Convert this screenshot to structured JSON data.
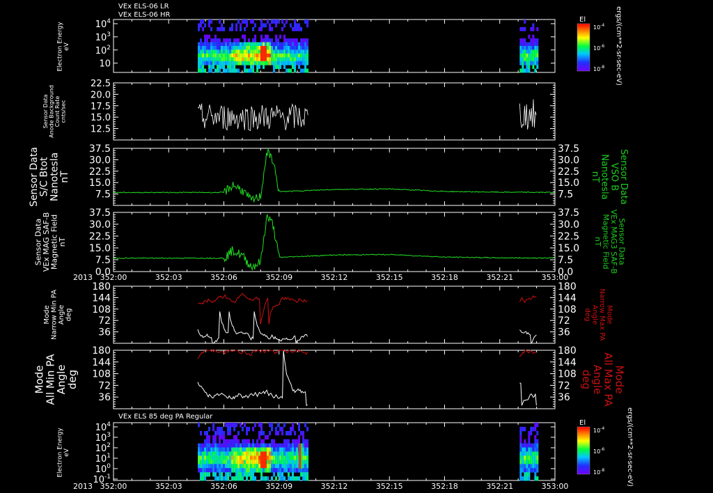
{
  "colors": {
    "background": "#000000",
    "axis": "#ffffff",
    "white_trace": "#ffffff",
    "green_trace": "#22dd22",
    "red_trace": "#cc1111",
    "green_label": "#1fcf1f",
    "red_label": "#cc1111"
  },
  "chart_data": [
    {
      "type": "heatmap",
      "title_lines": [
        "VEx ELS-06 LR",
        "VEx ELS-06 HR"
      ],
      "ylabel": [
        "Electron Energy",
        "eV"
      ],
      "yscale": "log",
      "ytick_labels": [
        [
          "10",
          "4"
        ],
        [
          "10",
          "3"
        ],
        [
          "10",
          "2"
        ],
        [
          "10",
          ""
        ]
      ],
      "colorbar": {
        "title": "El",
        "tick_labels": [
          [
            "10",
            "-4"
          ],
          [
            "10",
            "-6"
          ],
          [
            "10",
            "-8"
          ]
        ],
        "unit_label": "ergs/(cm**2-sr-sec-eV)"
      },
      "data_intervals": [
        [
          "352:04:35",
          "352:10:35"
        ],
        [
          "352:22:05",
          "352:23:00"
        ]
      ]
    },
    {
      "type": "line",
      "ylabel": [
        "Sensor Data",
        "Anode Background",
        "Count Rate",
        "cnts/sec"
      ],
      "ylim": [
        10.0,
        22.5
      ],
      "yticks": [
        "22.5",
        "20.0",
        "17.5",
        "15.0",
        "12.5"
      ],
      "series": [
        {
          "color": "white",
          "x_start": "352:04:35",
          "x_end": "352:10:35",
          "range": [
            12.0,
            18.0
          ]
        },
        {
          "color": "white",
          "x_start": "352:22:05",
          "x_end": "352:23:00",
          "range": [
            12.0,
            19.0
          ]
        }
      ]
    },
    {
      "type": "line",
      "ylabel": [
        "Sensor Data",
        "S/C Btot",
        "Nanotesla",
        "nT"
      ],
      "right_label": [
        "Sensor Data",
        "VSO B",
        "Nanotesla",
        "nT"
      ],
      "ylim": [
        0,
        37.5
      ],
      "yticks": [
        "37.5",
        "30.0",
        "22.5",
        "15.0",
        "7.5"
      ],
      "series": [
        {
          "color": "green",
          "baseline": 8.5,
          "x": [
            "352:00",
            "352:06",
            "352:06:30",
            "352:07",
            "352:07:30",
            "352:08",
            "352:08:20",
            "352:08:40",
            "352:09",
            "352:12",
            "352:15",
            "352:18",
            "352:21",
            "352:23"
          ],
          "y": [
            8.5,
            8.5,
            13.5,
            10.0,
            3.0,
            6.0,
            35.0,
            30.0,
            9.0,
            10.5,
            10.8,
            9.2,
            8.7,
            8.6
          ]
        }
      ]
    },
    {
      "type": "line",
      "ylabel": [
        "Sensor Data",
        "VEx MAG SAF-B",
        "Magnetic Field",
        "nT"
      ],
      "right_label": [
        "Sensor Data",
        "VEx MAG3 SAF-B",
        "Magnetic Field",
        "nT"
      ],
      "ylim": [
        0,
        37.5
      ],
      "yticks": [
        "37.5",
        "30.0",
        "22.5",
        "15.0",
        "7.5",
        "0.0"
      ],
      "x_tick_labels": [
        "352:00",
        "352:03",
        "352:06",
        "352:09",
        "352:12",
        "352:15",
        "352:18",
        "352:21",
        "353:00"
      ],
      "x_year_label": "2013",
      "series": [
        {
          "color": "green",
          "x": [
            "352:00",
            "352:06",
            "352:06:30",
            "352:07",
            "352:07:30",
            "352:08",
            "352:08:20",
            "352:08:40",
            "352:09",
            "352:12",
            "352:15",
            "352:18",
            "352:21",
            "352:23"
          ],
          "y": [
            8.5,
            8.5,
            13.5,
            10.0,
            3.0,
            6.0,
            35.0,
            30.0,
            9.0,
            10.5,
            10.8,
            9.2,
            8.7,
            8.6
          ]
        }
      ]
    },
    {
      "type": "line",
      "ylabel": [
        "Mode",
        "Narrow Min PA",
        "Angle",
        "deg"
      ],
      "right_label": [
        "Mode",
        "Narrow Max PA",
        "Angle",
        "deg"
      ],
      "ylim": [
        0,
        180
      ],
      "yticks": [
        "180",
        "144",
        "108",
        "72",
        "36"
      ],
      "series": [
        {
          "name": "Min PA",
          "color": "white",
          "intervals": [
            [
              "352:04:35",
              "352:10:35"
            ],
            [
              "352:22:05",
              "352:23:00"
            ]
          ],
          "range": [
            0,
            100
          ]
        },
        {
          "name": "Max PA",
          "color": "red",
          "intervals": [
            [
              "352:04:35",
              "352:10:35"
            ],
            [
              "352:22:05",
              "352:23:00"
            ]
          ],
          "range": [
            60,
            180
          ]
        }
      ]
    },
    {
      "type": "line",
      "ylabel": [
        "Mode",
        "All Min PA",
        "Angle",
        "deg"
      ],
      "right_label": [
        "Mode",
        "All Max PA",
        "Angle",
        "deg"
      ],
      "ylim": [
        0,
        180
      ],
      "yticks": [
        "180",
        "144",
        "108",
        "72",
        "36"
      ],
      "series": [
        {
          "name": "Min PA",
          "color": "white",
          "intervals": [
            [
              "352:04:35",
              "352:10:35"
            ],
            [
              "352:22:05",
              "352:23:00"
            ]
          ],
          "range": [
            10,
            180
          ]
        },
        {
          "name": "Max PA",
          "color": "red",
          "intervals": [
            [
              "352:04:35",
              "352:10:35"
            ],
            [
              "352:22:05",
              "352:23:00"
            ]
          ],
          "range": [
            120,
            180
          ]
        }
      ]
    },
    {
      "type": "heatmap",
      "title_lines": [
        "VEx ELS 85 deg PA Regular"
      ],
      "ylabel": [
        "Electron Energy",
        "eV"
      ],
      "yscale": "log",
      "ytick_labels": [
        [
          "10",
          "4"
        ],
        [
          "10",
          "3"
        ],
        [
          "10",
          "2"
        ],
        [
          "10",
          "1"
        ],
        [
          "10",
          "0"
        ],
        [
          "10",
          "-1"
        ]
      ],
      "colorbar": {
        "title": "El",
        "tick_labels": [
          [
            "10",
            "-4"
          ],
          [
            "10",
            "-6"
          ],
          [
            "10",
            "-8"
          ]
        ],
        "unit_label": "ergs/(cm**2-sr-sec-eV)"
      },
      "x_tick_labels": [
        "352:00",
        "352:03",
        "352:06",
        "352:09",
        "352:12",
        "352:15",
        "352:18",
        "352:21",
        "353:00"
      ],
      "x_year_label": "2013",
      "data_intervals": [
        [
          "352:04:35",
          "352:10:35"
        ],
        [
          "352:22:05",
          "352:23:00"
        ]
      ]
    }
  ]
}
